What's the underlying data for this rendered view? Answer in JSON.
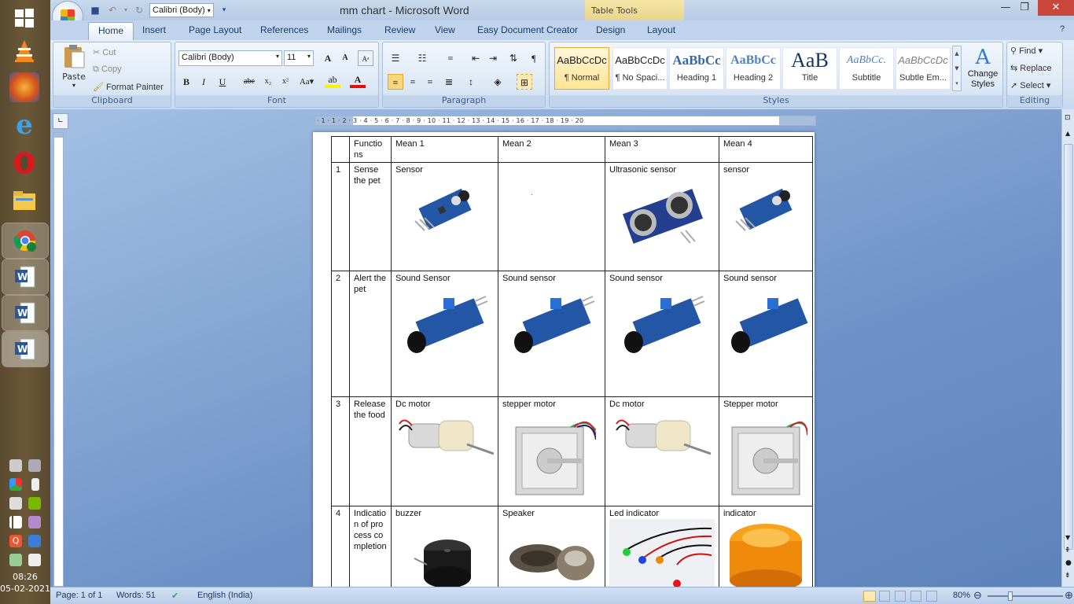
{
  "window": {
    "title": "mm chart - Microsoft Word",
    "contextual_tab_group": "Table Tools"
  },
  "qat": {
    "font_name": "Calibri (Body)"
  },
  "tabs": [
    "Home",
    "Insert",
    "Page Layout",
    "References",
    "Mailings",
    "Review",
    "View",
    "Easy Document Creator",
    "Design",
    "Layout"
  ],
  "clipboard": {
    "paste": "Paste",
    "cut": "Cut",
    "copy": "Copy",
    "format_painter": "Format Painter",
    "label": "Clipboard"
  },
  "font": {
    "name": "Calibri (Body)",
    "size": "11",
    "label": "Font"
  },
  "paragraph": {
    "label": "Paragraph"
  },
  "styles": {
    "items": [
      {
        "sample": "AaBbCcDc",
        "name": "¶ Normal"
      },
      {
        "sample": "AaBbCcDc",
        "name": "¶ No Spaci..."
      },
      {
        "sample": "AaBbCc",
        "name": "Heading 1"
      },
      {
        "sample": "AaBbCc",
        "name": "Heading 2"
      },
      {
        "sample": "AaB",
        "name": "Title"
      },
      {
        "sample": "AaBbCc.",
        "name": "Subtitle"
      },
      {
        "sample": "AaBbCcDc",
        "name": "Subtle Em..."
      }
    ],
    "change_styles": "Change Styles",
    "label": "Styles"
  },
  "editing": {
    "find": "Find",
    "replace": "Replace",
    "select": "Select",
    "label": "Editing"
  },
  "ruler": {
    "marks": "· 1 · 1 · 2 · 3 · 4 · 5 · 6 · 7 · 8 · 9 · 10 · 11 · 12 · 13 · 14 · 15 · 16 · 17 · 18 · 19 · 20"
  },
  "table": {
    "headers": [
      "",
      "Functions",
      "Mean 1",
      "Mean 2",
      "Mean 3",
      "Mean 4"
    ],
    "rows": [
      {
        "num": "1",
        "func": "Sense the pet",
        "cells": [
          "Sensor",
          "",
          "Ultrasonic sensor",
          "sensor"
        ]
      },
      {
        "num": "2",
        "func": "Alert the pet",
        "cells": [
          "Sound Sensor",
          "Sound sensor",
          "Sound sensor",
          "Sound sensor"
        ]
      },
      {
        "num": "3",
        "func": "Release the food",
        "cells": [
          "Dc motor",
          "stepper motor",
          "Dc motor",
          "Stepper  motor"
        ]
      },
      {
        "num": "4",
        "func": "Indication of process completion",
        "cells": [
          "buzzer",
          "Speaker",
          "Led indicator",
          "indicator"
        ]
      }
    ]
  },
  "statusbar": {
    "page": "Page: 1 of 1",
    "words": "Words: 51",
    "language": "English (India)",
    "zoom": "80%"
  },
  "clock": {
    "time": "08:26",
    "date": "05-02-2021"
  }
}
